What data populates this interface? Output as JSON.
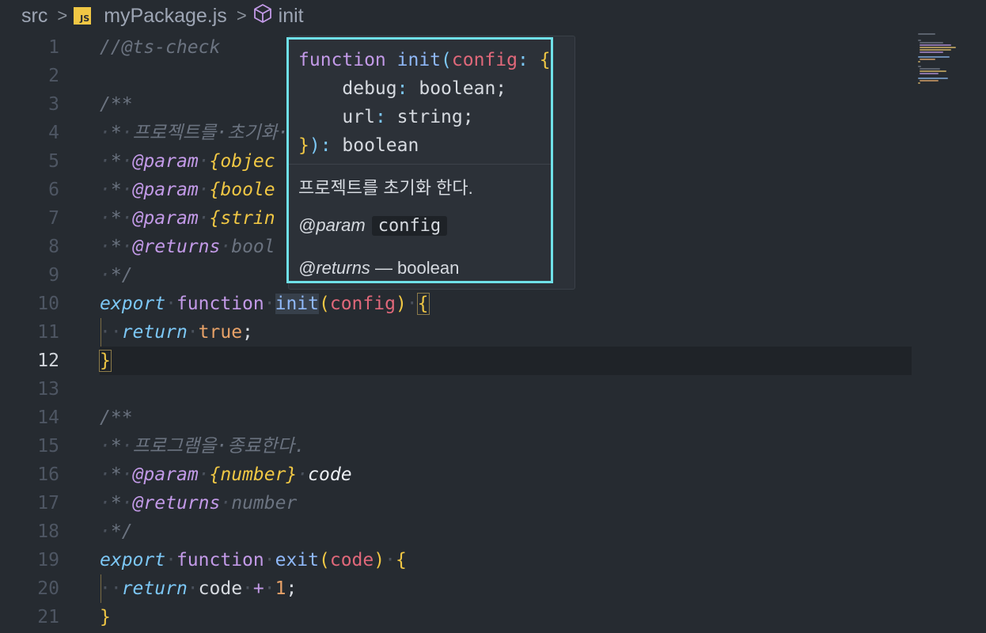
{
  "breadcrumb": {
    "folder": "src",
    "file_badge": "JS",
    "file": "myPackage.js",
    "symbol": "init"
  },
  "lines": {
    "l1": "//@ts-check",
    "l3": "/**",
    "l4": "프로젝트를·초기화·",
    "l5_tag": "@param",
    "l5_type": "{objec",
    "l6_tag": "@param",
    "l6_type": "{boole",
    "l7_tag": "@param",
    "l7_type": "{strin",
    "l8_tag": "@returns",
    "l8_val": "bool",
    "l9": "*/",
    "l10_export": "export",
    "l10_function": "function",
    "l10_name": "init",
    "l10_param": "config",
    "l11_return": "return",
    "l11_val": "true",
    "l12": "}",
    "l14": "/**",
    "l15": "프로그램을·종료한다.",
    "l16_tag": "@param",
    "l16_type": "{number}",
    "l16_name": "code",
    "l17_tag": "@returns",
    "l17_val": "number",
    "l18": "*/",
    "l19_export": "export",
    "l19_function": "function",
    "l19_name": "exit",
    "l19_param": "code",
    "l20_return": "return",
    "l20_var": "code",
    "l20_op": "+",
    "l20_num": "1",
    "l21": "}"
  },
  "hover": {
    "kw": "function",
    "name": "init",
    "param": "config",
    "f1_name": "debug",
    "f1_type": "boolean",
    "f2_name": "url",
    "f2_type": "string",
    "ret_type": "boolean",
    "description": "프로젝트를 초기화 한다.",
    "param_tag": "@param",
    "param_name": "config",
    "returns_tag": "@returns",
    "returns_text": "— boolean"
  },
  "colors": {
    "background": "#262B31",
    "hover_border": "#6FE0E8",
    "keyword": "#C39AE8",
    "function": "#8FB8F8",
    "parameter": "#E0687A",
    "type": "#F0C744"
  }
}
